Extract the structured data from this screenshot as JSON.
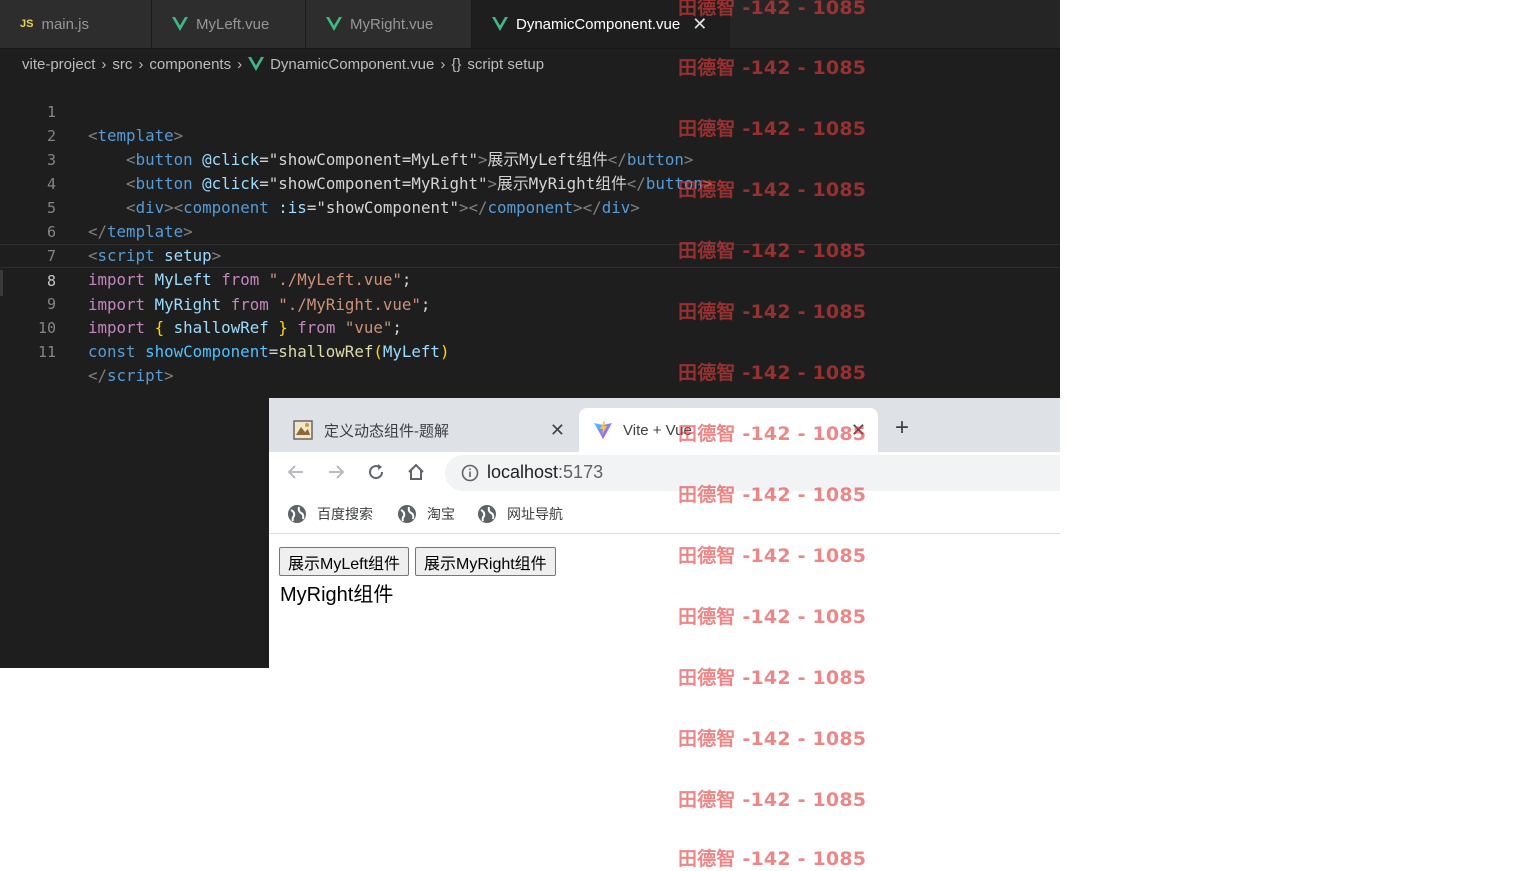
{
  "editor": {
    "tabs": [
      {
        "label": "main.js",
        "icon": "js-icon"
      },
      {
        "label": "MyLeft.vue",
        "icon": "vue-icon"
      },
      {
        "label": "MyRight.vue",
        "icon": "vue-icon"
      },
      {
        "label": "DynamicComponent.vue",
        "icon": "vue-icon",
        "active": true
      }
    ],
    "breadcrumb": [
      "vite-project",
      "src",
      "components",
      "DynamicComponent.vue",
      "script setup"
    ],
    "line_numbers": [
      "1",
      "2",
      "3",
      "4",
      "5",
      "6",
      "7",
      "8",
      "9",
      "10",
      "11"
    ],
    "current_line": "8",
    "code": {
      "l1": [
        "<",
        "template",
        ">"
      ],
      "l2": [
        "    ",
        "<",
        "button",
        " ",
        "@click",
        "=",
        "\"",
        "showComponent=MyLeft",
        "\"",
        ">",
        "展示MyLeft组件",
        "</",
        "button",
        ">"
      ],
      "l3": [
        "    ",
        "<",
        "button",
        " ",
        "@click",
        "=",
        "\"",
        "showComponent=MyRight",
        "\"",
        ">",
        "展示MyRight组件",
        "</",
        "button",
        ">"
      ],
      "l4": [
        "    ",
        "<",
        "div",
        "><",
        "component",
        " ",
        ":is",
        "=",
        "\"",
        "showComponent",
        "\"",
        "></",
        "component",
        "></",
        "div",
        ">"
      ],
      "l5": [
        "</",
        "template",
        ">"
      ],
      "l6": [
        "<",
        "script",
        " ",
        "setup",
        ">"
      ],
      "l7": [
        "import",
        " ",
        "MyLeft",
        " ",
        "from",
        " ",
        "\"./MyLeft.vue\"",
        ";"
      ],
      "l8": [
        "import",
        " ",
        "MyRight",
        " ",
        "from",
        " ",
        "\"./MyRight.vue\"",
        ";"
      ],
      "l9": [
        "import",
        " ",
        "{",
        " ",
        "shallowRef",
        " ",
        "}",
        " ",
        "from",
        " ",
        "\"vue\"",
        ";"
      ],
      "l10": [
        "const",
        " ",
        "showComponent",
        "=",
        "shallowRef",
        "(",
        "MyLeft",
        ")"
      ],
      "l11": [
        "</",
        "script",
        ">"
      ]
    }
  },
  "browser": {
    "tabs": [
      {
        "title": "定义动态组件-题解",
        "icon": "page-favicon"
      },
      {
        "title": "Vite + Vue",
        "icon": "vite-icon",
        "active": true
      }
    ],
    "new_tab_symbol": "+",
    "url_host": "localhost",
    "url_port": ":5173",
    "bookmarks": [
      "百度搜索",
      "淘宝",
      "网址导航"
    ],
    "page": {
      "buttons": [
        "展示MyLeft组件",
        "展示MyRight组件"
      ],
      "rendered_text": "MyRight组件"
    }
  },
  "watermark": {
    "text": "田德智 -142 - 1085",
    "color": "#e23c3c"
  }
}
